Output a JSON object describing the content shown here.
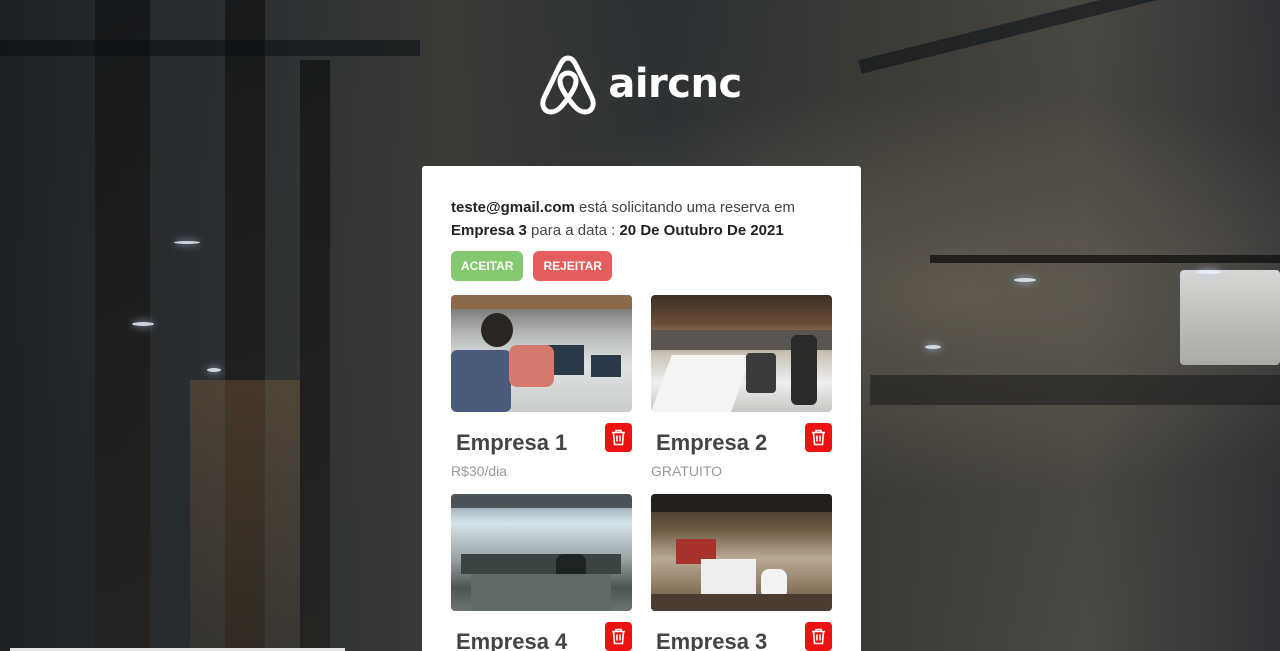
{
  "brand": {
    "name": "aircnc",
    "logo_icon": "airbnb-belo-icon"
  },
  "booking_request": {
    "email": "teste@gmail.com",
    "text_1": " está solicitando uma reserva em ",
    "spot": "Empresa 3",
    "text_2": " para a data : ",
    "date": "20 De Outubro De 2021",
    "accept_label": "ACEITAR",
    "reject_label": "REJEITAR"
  },
  "spots": [
    {
      "title": "Empresa 1",
      "price": "R$30/dia"
    },
    {
      "title": "Empresa 2",
      "price": "GRATUITO"
    },
    {
      "title": "Empresa 4",
      "price": ""
    },
    {
      "title": "Empresa 3",
      "price": ""
    }
  ],
  "colors": {
    "accept": "#84c870",
    "reject": "#e55e5e",
    "delete": "#ee1111"
  }
}
